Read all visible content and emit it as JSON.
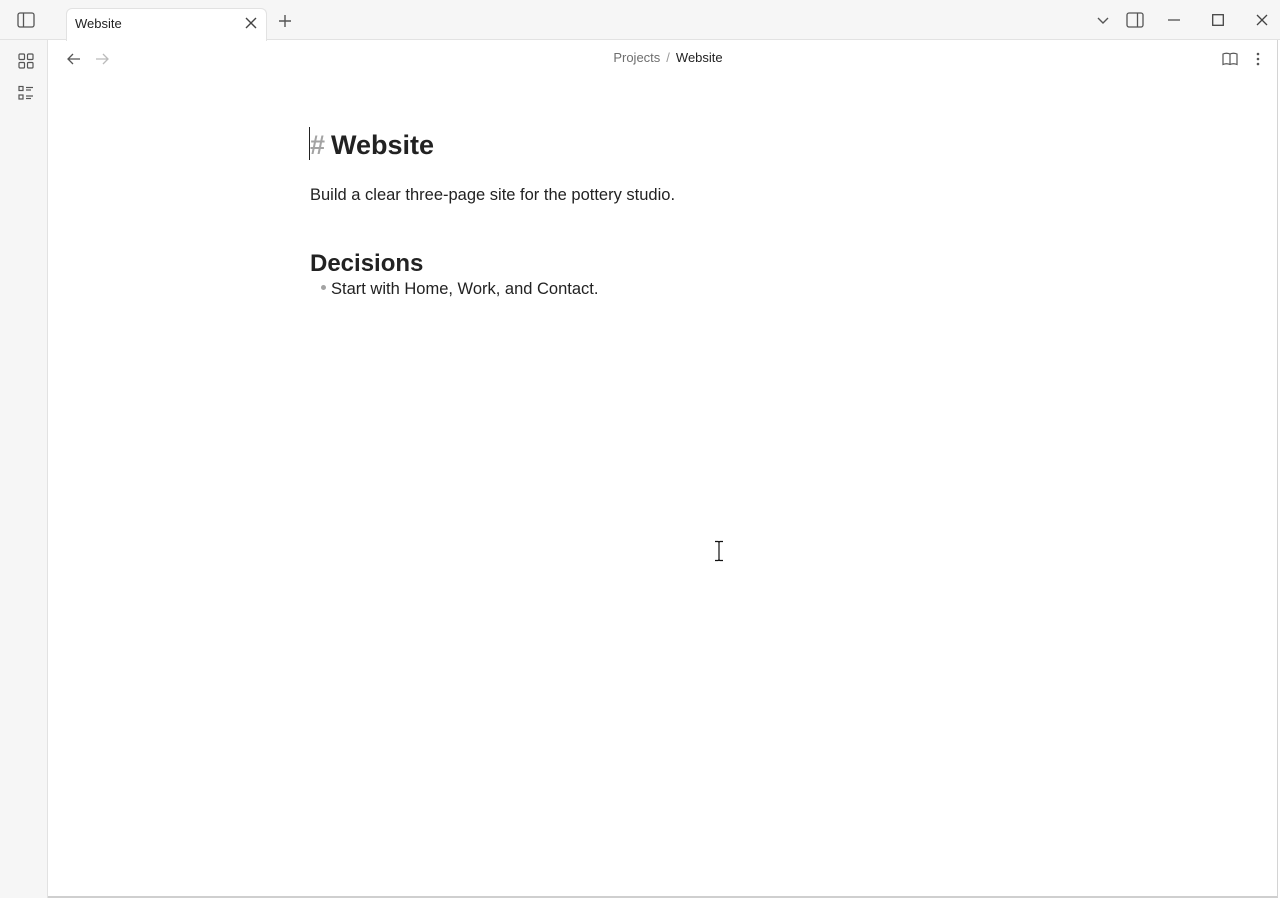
{
  "tabs": [
    {
      "label": "Website",
      "active": true
    }
  ],
  "breadcrumb": {
    "parent": "Projects",
    "separator": "/",
    "current": "Website"
  },
  "note": {
    "title_marker": "#",
    "title": "Website",
    "paragraph": "Build a clear three-page site for the pottery studio.",
    "sections": [
      {
        "heading": "Decisions",
        "bullets": [
          "Start with Home, Work, and Contact."
        ]
      }
    ]
  },
  "icons": {
    "sidebar_toggle": "sidebar-toggle-icon",
    "new_tab": "plus-icon",
    "tab_list": "chevron-down-icon",
    "right_sidebar": "right-sidebar-toggle-icon",
    "minimize": "minimize-icon",
    "maximize": "maximize-icon",
    "close": "close-icon",
    "ribbon": [
      "grid-icon",
      "list-icon"
    ],
    "back": "arrow-left-icon",
    "forward": "arrow-right-icon",
    "reading_view": "book-open-icon",
    "more": "more-vertical-icon"
  },
  "colors": {
    "text": "#222222",
    "muted": "#a3a3a3",
    "chrome_bg": "#f6f6f6"
  }
}
